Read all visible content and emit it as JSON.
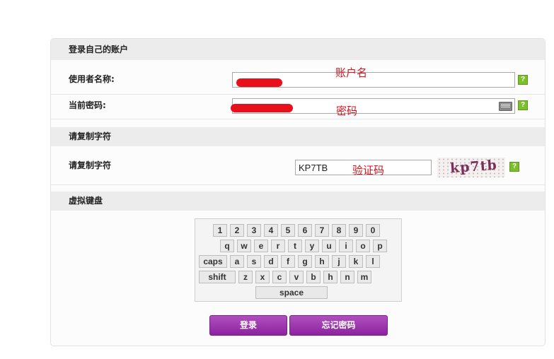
{
  "login_section": {
    "title": "登录自己的账户",
    "username_label": "使用者名称:",
    "username_annotation": "账户名",
    "password_label": "当前密码:",
    "password_annotation": "密码",
    "help_glyph": "?"
  },
  "captcha_section": {
    "title": "请复制字符",
    "label": "请复制字符",
    "value": "KP7TB",
    "annotation": "验证码",
    "captcha_image_text": "kp7tb"
  },
  "keyboard_section": {
    "title": "虚拟键盘",
    "rows": [
      [
        "1",
        "2",
        "3",
        "4",
        "5",
        "6",
        "7",
        "8",
        "9",
        "0"
      ],
      [
        "q",
        "w",
        "e",
        "r",
        "t",
        "y",
        "u",
        "i",
        "o",
        "p"
      ],
      [
        "caps",
        "a",
        "s",
        "d",
        "f",
        "g",
        "h",
        "j",
        "k",
        "l"
      ],
      [
        "shift",
        "z",
        "x",
        "c",
        "v",
        "b",
        "h",
        "n",
        "m"
      ],
      [
        "space"
      ]
    ]
  },
  "buttons": {
    "login": "登录",
    "forgot_password": "忘记密码"
  },
  "colors": {
    "accent": "#9b2fae",
    "help": "#7dbf2a",
    "annotation": "#d3141c"
  }
}
